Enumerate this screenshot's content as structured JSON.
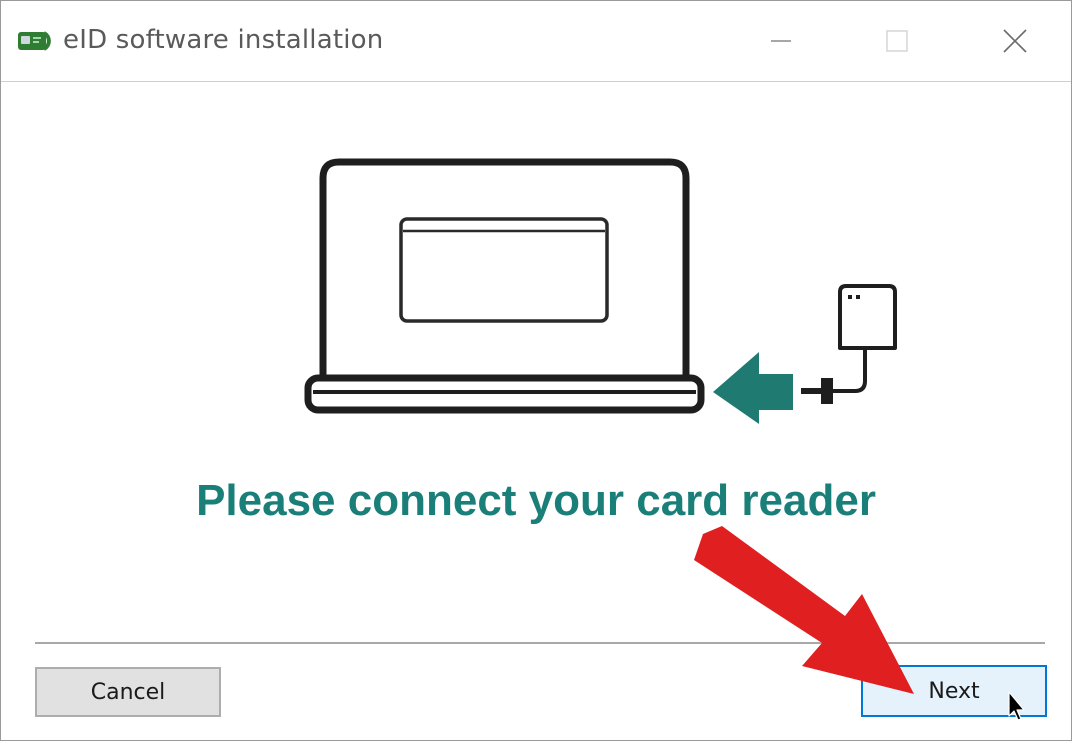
{
  "window": {
    "title": "eID software installation",
    "app_icon": "eid-card-icon",
    "controls": {
      "minimize_icon": "minimize-icon",
      "maximize_icon": "maximize-icon",
      "close_icon": "close-icon"
    }
  },
  "main": {
    "heading": "Please connect your card reader",
    "heading_color": "#1a7f78",
    "illustration": {
      "laptop_icon": "laptop-icon",
      "arrow_icon": "arrow-left-icon",
      "reader_icon": "card-reader-icon"
    }
  },
  "footer": {
    "cancel_label": "Cancel",
    "next_label": "Next"
  },
  "annotations": {
    "arrow_color": "#e02020",
    "cursor_icon": "mouse-pointer-icon"
  }
}
